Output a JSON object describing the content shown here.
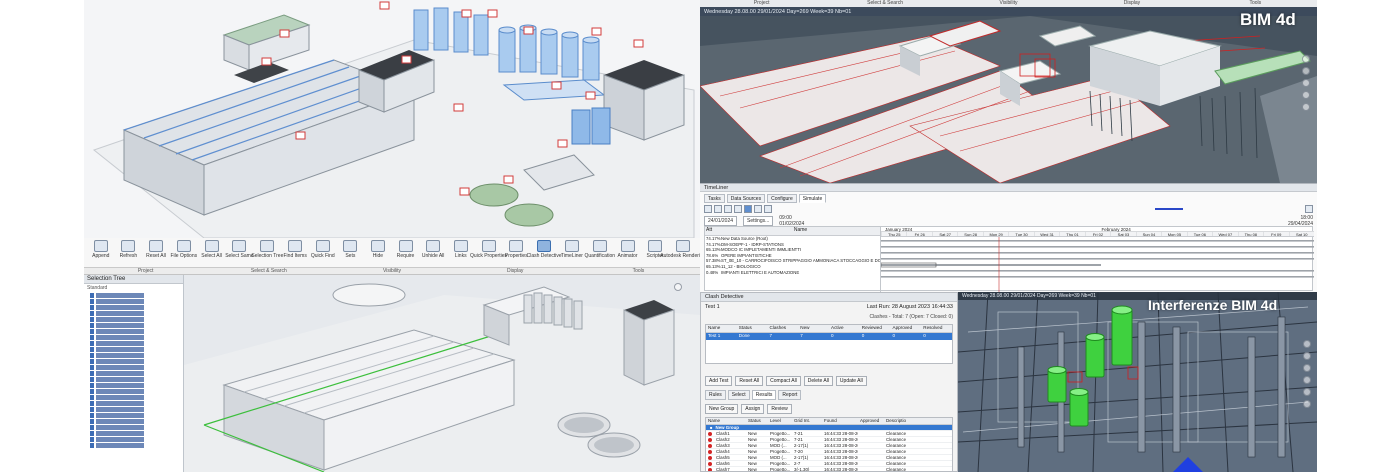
{
  "panel_plant": {
    "tags": [
      "1",
      "2",
      "3",
      "4",
      "5",
      "6",
      "7",
      "8",
      "9",
      "10",
      "11",
      "12",
      "13",
      "14",
      "15",
      "16",
      "17",
      "18",
      "19",
      "20"
    ]
  },
  "panel_navis": {
    "ribbon_buttons": [
      "Append",
      "Refresh",
      "Reset All",
      "File Options",
      "Select All",
      "Select Same",
      "Selection Tree",
      "Find Items",
      "Quick Find",
      "Sets",
      "Hide",
      "Require",
      "Unhide All",
      "Links",
      "Quick Properties",
      "Properties",
      "Clash Detective",
      "TimeLiner",
      "Quantification",
      "Animator",
      "Scripter",
      "Autodesk Rendering",
      "Appearance Profiler",
      "Batch Utility",
      "Compare",
      "DataTools",
      "App Manager"
    ],
    "ribbon_groups": [
      "Project",
      "Select & Search",
      "Visibility",
      "Display",
      "Tools"
    ],
    "selection_tree_title": "Selection Tree",
    "selection_tree_mode": "Standard"
  },
  "panel_4d": {
    "menu": [
      "Project",
      "Select & Search",
      "Visibility",
      "Display",
      "Tools"
    ],
    "status": "Wednesday 28.08.00 29/01/2024 Day=269 Week=39 Nb=01",
    "label": "BIM 4d",
    "timeliner": {
      "title": "TimeLiner",
      "tabs": [
        "Tasks",
        "Data Sources",
        "Configure",
        "Simulate"
      ],
      "active_tab": "Simulate",
      "start_date": "24/01/2024",
      "settings_label": "Settings...",
      "current_time": "09:00",
      "current_date": "01/02/2024",
      "end_time": "18:00",
      "end_date": "29/04/2024",
      "col_active": "Att",
      "col_name": "Name",
      "tasks": [
        {
          "pct": "74.17%",
          "name": "New Data Source (Root)"
        },
        {
          "pct": "74.17%",
          "name": "DM-SOEPF-1 - IDRP-STATIONS"
        },
        {
          "pct": "65.13%",
          "name": "MODCO IC IMPLETAMENTI IMMLIENTTI"
        },
        {
          "pct": "78.6%",
          "name": "OPERE IMPIANTISTICHE"
        },
        {
          "pct": "57.38%",
          "name": "ST_0E_10 - CARROCIFOISCO STRIPPAGGIO AMMONIACA STOCCAGGIO E DOSAGGIO REAG."
        },
        {
          "pct": "65.13%",
          "name": "11_12 - BIOLOGICO"
        },
        {
          "pct": "0.48%",
          "name": "IMPIANTI ELETTRICI E AUTOMAZIONE"
        }
      ],
      "months": [
        "January 2024",
        "February 2024"
      ],
      "days": [
        "Thu 25",
        "Fri 26",
        "Sat 27",
        "Sun 28",
        "Mon 29",
        "Tue 30",
        "Wed 31",
        "Thu 01",
        "Fri 02",
        "Sat 03",
        "Sun 04",
        "Mon 05",
        "Tue 06",
        "Wed 07",
        "Thu 08",
        "Fri 09",
        "Sat 10"
      ]
    }
  },
  "panel_clash": {
    "title": "Clash Detective",
    "test_name": "Test 1",
    "last_run": "Last Run: 28 August 2023 16:44:33",
    "summary": "Clashes - Total: 7 (Open: 7 Closed: 0)",
    "columns": [
      "Name",
      "Status",
      "Clashes",
      "New",
      "Active",
      "Reviewed",
      "Approved",
      "Resolved"
    ],
    "row": [
      "Test 1",
      "Done",
      "7",
      "7",
      "0",
      "0",
      "0",
      "0"
    ],
    "buttons": [
      "Add Test",
      "Reset All",
      "Compact All",
      "Delete All",
      "Update All"
    ],
    "tabs": [
      "Rules",
      "Select",
      "Results",
      "Report"
    ],
    "active_tab": "Results",
    "tools": [
      "New Group",
      "Assign",
      "Review"
    ],
    "result_columns": [
      "Name",
      "Status",
      "Level",
      "Grid Int.",
      "Found",
      "Approved",
      "Description"
    ],
    "group_name": "New Group",
    "results": [
      {
        "name": "Clash1",
        "status": "New",
        "level": "Progetto...",
        "grid": "7-21",
        "found": "16:44:33 28-08-2023",
        "desc": "Clearance"
      },
      {
        "name": "Clash2",
        "status": "New",
        "level": "Progetto...",
        "grid": "7-21",
        "found": "16:44:33 28-08-2023",
        "desc": "Clearance"
      },
      {
        "name": "Clash3",
        "status": "New",
        "level": "MOD (...",
        "grid": "2-17(1)",
        "found": "16:44:33 28-08-2023",
        "desc": "Clearance"
      },
      {
        "name": "Clash4",
        "status": "New",
        "level": "Progetto...",
        "grid": "7-20",
        "found": "16:44:33 28-08-2023",
        "desc": "Clearance"
      },
      {
        "name": "Clash5",
        "status": "New",
        "level": "MOD (...",
        "grid": "2-17(1)",
        "found": "16:44:33 28-08-2023",
        "desc": "Clearance"
      },
      {
        "name": "Clash6",
        "status": "New",
        "level": "Progetto...",
        "grid": "2-7",
        "found": "16:44:33 28-08-2023",
        "desc": "Clearance"
      },
      {
        "name": "Clash7",
        "status": "New",
        "level": "Progetto...",
        "grid": "3(-1.30)",
        "found": "16:44:33 28-08-2023",
        "desc": "Clearance"
      }
    ]
  },
  "panel_clash3d": {
    "status": "Wednesday 28.08.00 29/01/2024 Day=269 Week=39 Nb=01",
    "label": "Interferenze BIM 4d"
  }
}
